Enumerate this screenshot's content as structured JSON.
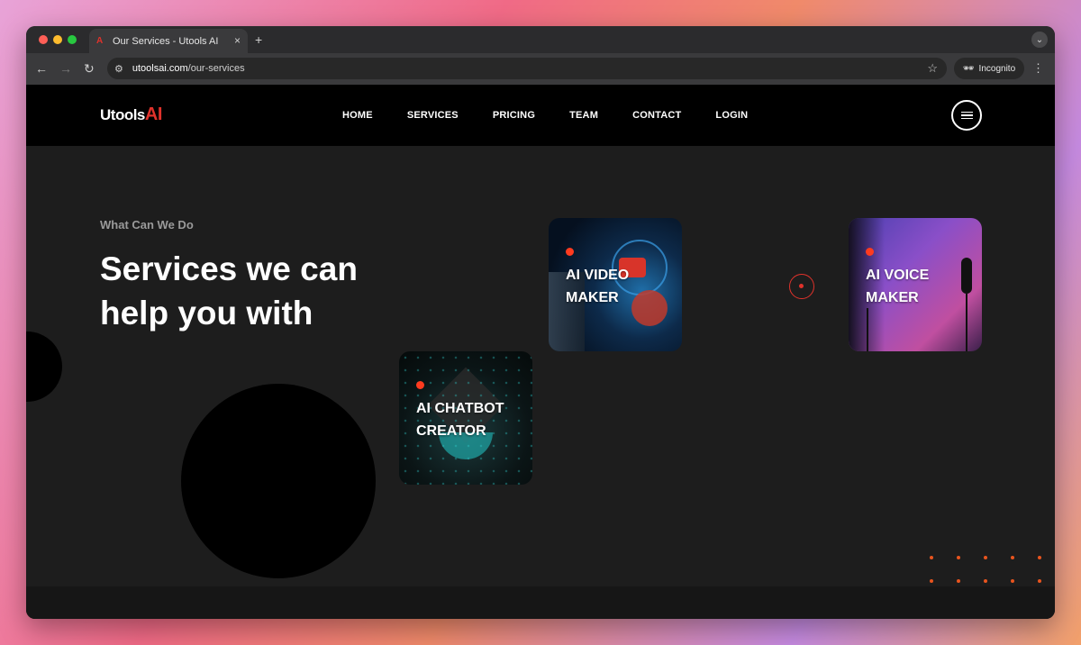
{
  "browser": {
    "tab_title": "Our Services - Utools AI",
    "tab_close": "×",
    "new_tab": "+",
    "url_host": "utoolsai.com",
    "url_path": "/our-services",
    "incognito_label": "Incognito"
  },
  "site": {
    "logo_text": "Utools",
    "logo_accent": "AI",
    "nav": [
      "HOME",
      "SERVICES",
      "PRICING",
      "TEAM",
      "CONTACT",
      "LOGIN"
    ]
  },
  "hero": {
    "kicker": "What Can We Do",
    "headline_line1": "Services we can",
    "headline_line2": "help you with"
  },
  "services": [
    {
      "line1": "AI VIDEO",
      "line2": "MAKER"
    },
    {
      "line1": "AI VOICE",
      "line2": "MAKER"
    },
    {
      "line1": "AI CHATBOT",
      "line2": "CREATOR"
    }
  ],
  "colors": {
    "accent": "#e0322b",
    "dot": "#ff3b1f",
    "background": "#1d1d1d",
    "header": "#000000"
  }
}
